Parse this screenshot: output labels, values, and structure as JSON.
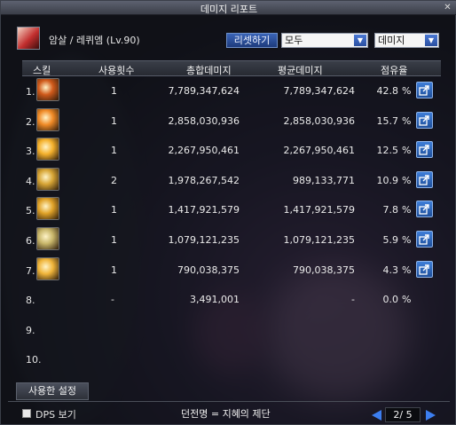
{
  "window": {
    "title": "데미지 리포트",
    "close_label": "✕"
  },
  "header": {
    "character": "암살 / 레퀴엠 (Lv.90)",
    "reset_label": "리셋하기",
    "filter_target": "모두",
    "filter_metric": "데미지"
  },
  "columns": {
    "skill": "스킬",
    "count": "사용횟수",
    "total": "총합데미지",
    "average": "평균데미지",
    "share": "점유율"
  },
  "rows": [
    {
      "rank": "1.",
      "icon": "skill-icon-1",
      "color": "#d05a1b",
      "count": "1",
      "total": "7,789,347,624",
      "average": "7,789,347,624",
      "share": "42.8",
      "pct": "%"
    },
    {
      "rank": "2.",
      "icon": "skill-icon-2",
      "color": "#f08a26",
      "count": "1",
      "total": "2,858,030,936",
      "average": "2,858,030,936",
      "share": "15.7",
      "pct": "%"
    },
    {
      "rank": "3.",
      "icon": "skill-icon-3",
      "color": "#f5b12c",
      "count": "1",
      "total": "2,267,950,461",
      "average": "2,267,950,461",
      "share": "12.5",
      "pct": "%"
    },
    {
      "rank": "4.",
      "icon": "skill-icon-4",
      "color": "#d7a535",
      "count": "2",
      "total": "1,978,267,542",
      "average": "989,133,771",
      "share": "10.9",
      "pct": "%"
    },
    {
      "rank": "5.",
      "icon": "skill-icon-5",
      "color": "#e0a228",
      "count": "1",
      "total": "1,417,921,579",
      "average": "1,417,921,579",
      "share": "7.8",
      "pct": "%"
    },
    {
      "rank": "6.",
      "icon": "skill-icon-6",
      "color": "#c8b66a",
      "count": "1",
      "total": "1,079,121,235",
      "average": "1,079,121,235",
      "share": "5.9",
      "pct": "%"
    },
    {
      "rank": "7.",
      "icon": "skill-icon-7",
      "color": "#f0b53a",
      "count": "1",
      "total": "790,038,375",
      "average": "790,038,375",
      "share": "4.3",
      "pct": "%"
    },
    {
      "rank": "8.",
      "icon": "",
      "color": "",
      "count": "-",
      "total": "3,491,001",
      "average": "-",
      "share": "0.0",
      "pct": "%"
    },
    {
      "rank": "9.",
      "icon": "",
      "color": "",
      "count": "",
      "total": "",
      "average": "",
      "share": "",
      "pct": ""
    },
    {
      "rank": "10.",
      "icon": "",
      "color": "",
      "count": "",
      "total": "",
      "average": "",
      "share": "",
      "pct": ""
    }
  ],
  "footer": {
    "settings_tab": "사용한 설정",
    "dps_label": "DPS 보기",
    "dungeon": "던전명 = 지혜의 제단",
    "page": "2/ 5"
  },
  "colors": {
    "accent": "#3c7ef0",
    "button": "#2a55a8"
  }
}
